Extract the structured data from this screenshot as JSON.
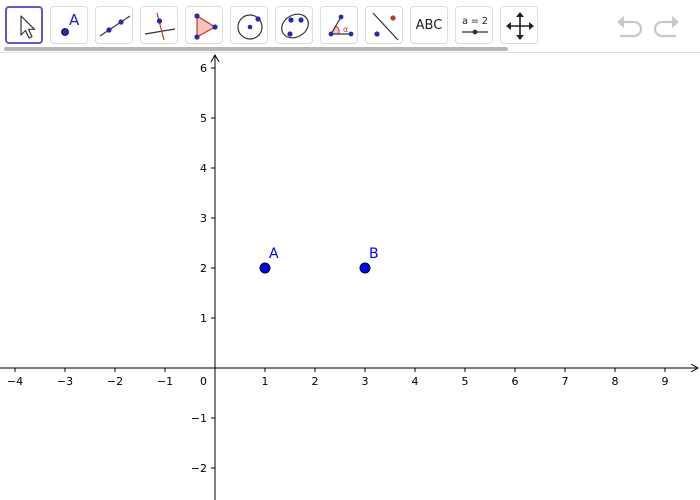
{
  "toolbar": {
    "tools": [
      {
        "name": "move-tool",
        "selected": true
      },
      {
        "name": "point-tool",
        "label": "A"
      },
      {
        "name": "line-tool"
      },
      {
        "name": "perpendicular-line-tool"
      },
      {
        "name": "polygon-tool"
      },
      {
        "name": "circle-tool"
      },
      {
        "name": "conic-tool"
      },
      {
        "name": "angle-tool",
        "label": "α"
      },
      {
        "name": "reflect-tool"
      },
      {
        "name": "text-tool",
        "label": "ABC"
      },
      {
        "name": "slider-tool",
        "label": "a = 2"
      },
      {
        "name": "move-graphics-view-tool"
      }
    ],
    "undo_icon": "undo-icon",
    "redo_icon": "redo-icon"
  },
  "graphics": {
    "x_ticks": [
      -4,
      -3,
      -2,
      -1,
      0,
      1,
      2,
      3,
      4,
      5,
      6,
      7,
      8,
      9
    ],
    "y_ticks": [
      -2,
      -1,
      1,
      2,
      3,
      4,
      5,
      6
    ],
    "origin_label": "0",
    "points": [
      {
        "label": "A",
        "x": 1,
        "y": 2
      },
      {
        "label": "B",
        "x": 3,
        "y": 2
      }
    ],
    "point_color": "#0000ff",
    "label_color": "#0000ff"
  }
}
